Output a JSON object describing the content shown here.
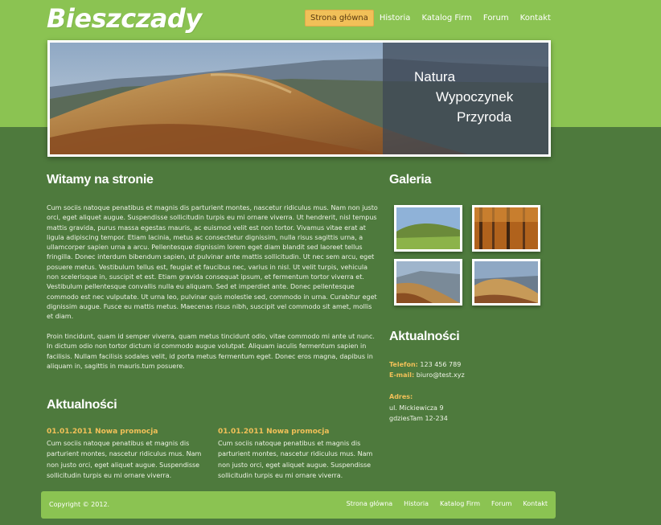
{
  "site": {
    "logo": "Bieszczady"
  },
  "nav": {
    "items": [
      "Strona główna",
      "Historia",
      "Katalog Firm",
      "Forum",
      "Kontakt"
    ]
  },
  "banner": {
    "line1": "Natura",
    "line2": "Wypoczynek",
    "line3": "Przyroda"
  },
  "welcome": {
    "heading": "Witamy na stronie",
    "para1": "Cum sociis natoque penatibus et magnis dis parturient montes, nascetur ridiculus mus. Nam non justo orci, eget aliquet augue. Suspendisse sollicitudin turpis eu mi ornare viverra. Ut hendrerit, nisl tempus mattis gravida, purus massa egestas mauris, ac euismod velit est non tortor. Vivamus vitae erat at ligula adipiscing tempor. Etiam lacinia, metus ac consectetur dignissim, nulla risus sagittis urna, a ullamcorper sapien urna a arcu. Pellentesque dignissim lorem eget diam blandit sed laoreet tellus fringilla. Donec interdum bibendum sapien, ut pulvinar ante mattis sollicitudin. Ut nec sem arcu, eget posuere metus. Vestibulum tellus est, feugiat et faucibus nec, varius in nisl. Ut velit turpis, vehicula non scelerisque in, suscipit et est. Etiam gravida consequat ipsum, et fermentum tortor viverra et. Vestibulum pellentesque convallis nulla eu aliquam. Sed et imperdiet ante. Donec pellentesque commodo est nec vulputate. Ut urna leo, pulvinar quis molestie sed, commodo in urna. Curabitur eget dignissim augue. Fusce eu mattis metus. Maecenas risus nibh, suscipit vel commodo sit amet, mollis et diam.",
    "para2": "Proin tincidunt, quam id semper viverra, quam metus tincidunt odio, vitae commodo mi ante ut nunc. In dictum odio non tortor dictum id commodo augue volutpat. Aliquam iaculis fermentum sapien in facilisis. Nullam facilisis sodales velit, id porta metus fermentum eget. Donec eros magna, dapibus in aliquam in, sagittis in mauris.tum posuere."
  },
  "news": {
    "heading": "Aktualności",
    "items": [
      {
        "title": "01.01.2011 Nowa promocja",
        "text": "Cum sociis natoque penatibus et magnis dis parturient montes, nascetur ridiculus mus. Nam non justo orci, eget aliquet augue. Suspendisse sollicitudin turpis eu mi ornare viverra."
      },
      {
        "title": "01.01.2011 Nowa promocja",
        "text": "Cum sociis natoque penatibus et magnis dis parturient montes, nascetur ridiculus mus. Nam non justo orci, eget aliquet augue. Suspendisse sollicitudin turpis eu mi ornare viverra."
      }
    ]
  },
  "gallery": {
    "heading": "Galeria"
  },
  "contact": {
    "heading": "Aktualności",
    "phone_label": "Telefon:",
    "phone": "123 456 789",
    "email_label": "E-mail:",
    "email": "biuro@test.xyz",
    "address_label": "Adres:",
    "address1": "ul. Mickiewicza 9",
    "address2": "gdziesTam 12-234"
  },
  "footer": {
    "copyright": "Copyright © 2012.",
    "items": [
      "Strona główna",
      "Historia",
      "Katalog Firm",
      "Forum",
      "Kontakt"
    ]
  },
  "colors": {
    "light_green": "#8bc352",
    "dark_green": "#4e7a3d",
    "accent": "#f1c058"
  }
}
